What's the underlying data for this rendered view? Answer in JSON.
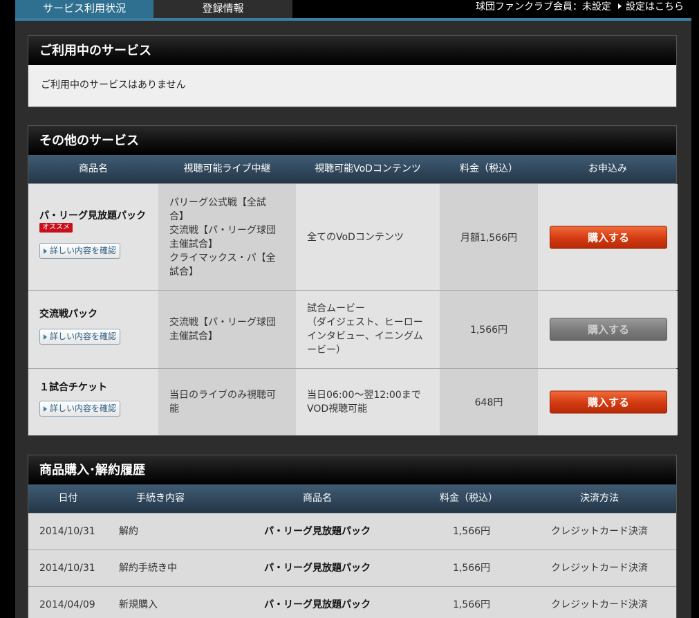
{
  "tabs": {
    "service_status": "サービス利用状況",
    "registration": "登録情報"
  },
  "fan_club": {
    "status": "球団ファンクラブ会員：未設定",
    "settings_link": "設定はこちら"
  },
  "current_services": {
    "title": "ご利用中のサービス",
    "empty_message": "ご利用中のサービスはありません"
  },
  "other_services": {
    "title": "その他のサービス",
    "headers": {
      "product": "商品名",
      "live": "視聴可能ライブ中継",
      "vod": "視聴可能VoDコンテンツ",
      "price": "料金（税込）",
      "apply": "お申込み"
    },
    "detail_label": "詳しい内容を確認",
    "buy_label": "購入する",
    "rows": [
      {
        "name": "パ・リーグ見放題パック",
        "badge": "オススメ",
        "live": [
          "パリーグ公式戦【全試",
          "合】",
          "交流戦【パ・リーグ球団",
          "主催試合】",
          "クライマックス・パ【全",
          "試合】"
        ],
        "vod": [
          "全てのVoDコンテンツ"
        ],
        "price": "月額1,566円",
        "buy_enabled": true
      },
      {
        "name": "交流戦パック",
        "badge": "",
        "live": [
          "交流戦【パ・リーグ球団",
          "主催試合】"
        ],
        "vod": [
          "試合ムービー",
          "（ダイジェスト、ヒーロー",
          "インタビュー、イニングム",
          "ービー）"
        ],
        "price": "1,566円",
        "buy_enabled": false
      },
      {
        "name": "１試合チケット",
        "badge": "",
        "live": [
          "当日のライブのみ視聴可",
          "能"
        ],
        "vod": [
          "当日06:00～翌12:00まで",
          "VOD視聴可能"
        ],
        "price": "648円",
        "buy_enabled": true
      }
    ]
  },
  "history": {
    "title": "商品購入･解約履歴",
    "headers": {
      "date": "日付",
      "procedure": "手続き内容",
      "product": "商品名",
      "price": "料金（税込）",
      "payment": "決済方法"
    },
    "rows": [
      {
        "date": "2014/10/31",
        "procedure": "解約",
        "product": "パ・リーグ見放題パック",
        "price": "1,566円",
        "payment": "クレジットカード決済"
      },
      {
        "date": "2014/10/31",
        "procedure": "解約手続き中",
        "product": "パ・リーグ見放題パック",
        "price": "1,566円",
        "payment": "クレジットカード決済"
      },
      {
        "date": "2014/04/09",
        "procedure": "新規購入",
        "product": "パ・リーグ見放題パック",
        "price": "1,566円",
        "payment": "クレジットカード決済"
      }
    ]
  }
}
